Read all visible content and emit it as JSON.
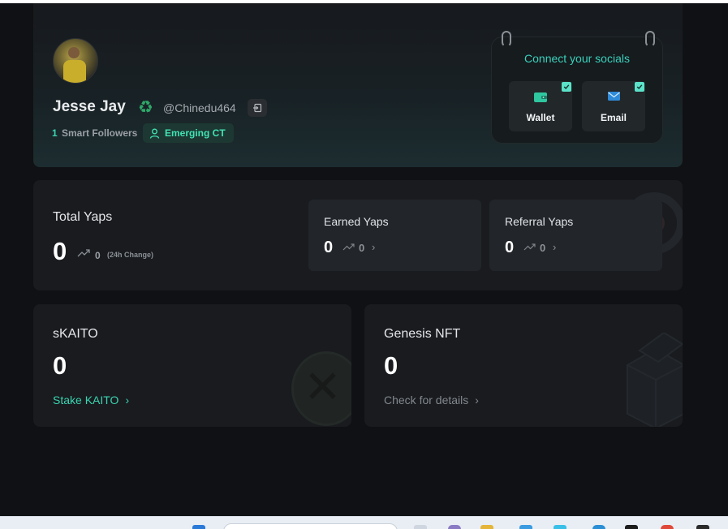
{
  "profile": {
    "name": "Jesse Jay",
    "handle": "@Chinedu464",
    "followers_count": "1",
    "followers_label": "Smart Followers",
    "badge_label": "Emerging CT"
  },
  "socials": {
    "title": "Connect your socials",
    "items": [
      {
        "label": "Wallet",
        "icon": "wallet-icon",
        "connected": true
      },
      {
        "label": "Email",
        "icon": "mail-icon",
        "connected": true
      }
    ]
  },
  "yaps": {
    "total_title": "Total Yaps",
    "total_value": "0",
    "change_value": "0",
    "change_label": "(24h Change)",
    "earned": {
      "title": "Earned Yaps",
      "value": "0",
      "change": "0"
    },
    "referral": {
      "title": "Referral Yaps",
      "value": "0",
      "change": "0"
    }
  },
  "skaito": {
    "title": "sKAITO",
    "value": "0",
    "link": "Stake KAITO"
  },
  "genesis": {
    "title": "Genesis NFT",
    "value": "0",
    "link": "Check for details"
  },
  "colors": {
    "accent": "#3ad4b0",
    "background": "#101114",
    "card": "#191b1f"
  }
}
